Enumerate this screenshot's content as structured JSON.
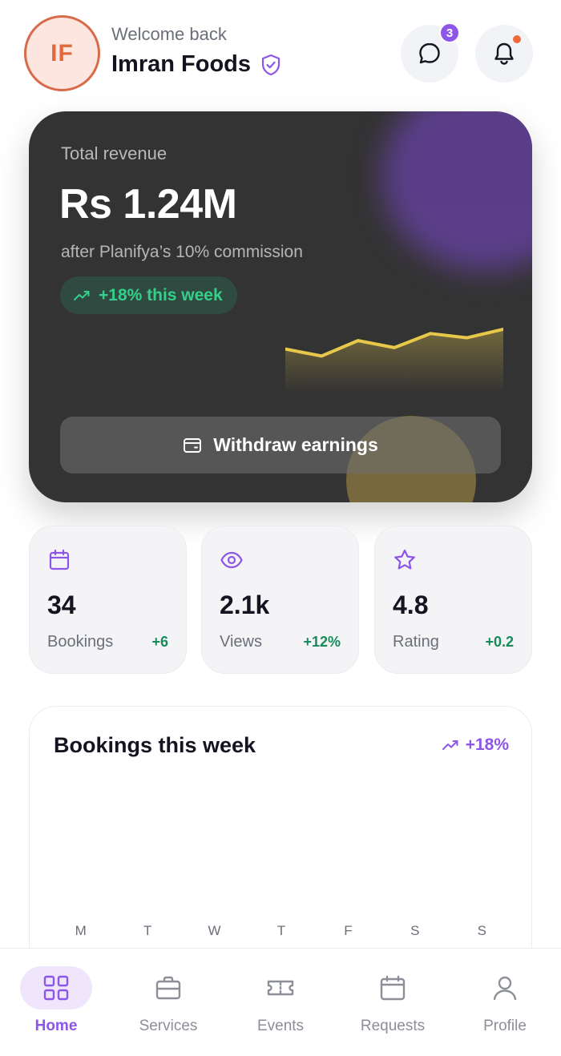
{
  "header": {
    "avatar_initials": "IF",
    "welcome": "Welcome back",
    "business_name": "Imran Foods",
    "verified_icon": "shield-check-icon",
    "messages_icon": "chat-bubble-icon",
    "messages_badge": "3",
    "notifications_icon": "bell-icon",
    "notification_dot_color": "#ee6a3a"
  },
  "revenue": {
    "label": "Total revenue",
    "amount": "Rs 1.24M",
    "subtitle": "after Planifya’s 10% commission",
    "trend": "+18% this week",
    "trend_icon": "trending-up-icon",
    "withdraw_label": "Withdraw earnings",
    "withdraw_icon": "wallet-icon",
    "sparkline": [
      0.72,
      0.62,
      0.84,
      0.74,
      0.94,
      0.88,
      1.0
    ],
    "accent_color": "#e7c84a"
  },
  "stats": [
    {
      "icon": "calendar-icon",
      "value": "34",
      "label": "Bookings",
      "change": "+6"
    },
    {
      "icon": "eye-icon",
      "value": "2.1k",
      "label": "Views",
      "change": "+12%"
    },
    {
      "icon": "star-icon",
      "value": "4.8",
      "label": "Rating",
      "change": "+0.2"
    }
  ],
  "bookings_chart": {
    "title": "Bookings this week",
    "trend": "+18%",
    "trend_icon": "trending-up-icon",
    "days": [
      "M",
      "T",
      "W",
      "T",
      "F",
      "S",
      "S"
    ]
  },
  "nav": {
    "items": [
      {
        "label": "Home",
        "icon": "grid-icon",
        "active": true
      },
      {
        "label": "Services",
        "icon": "briefcase-icon",
        "active": false
      },
      {
        "label": "Events",
        "icon": "ticket-icon",
        "active": false
      },
      {
        "label": "Requests",
        "icon": "calendar-icon",
        "active": false
      },
      {
        "label": "Profile",
        "icon": "user-icon",
        "active": false
      }
    ]
  },
  "colors": {
    "brand": "#8d55e8",
    "positive": "#168a5a",
    "positive_light": "#34d08a",
    "card_dark": "#333333"
  }
}
